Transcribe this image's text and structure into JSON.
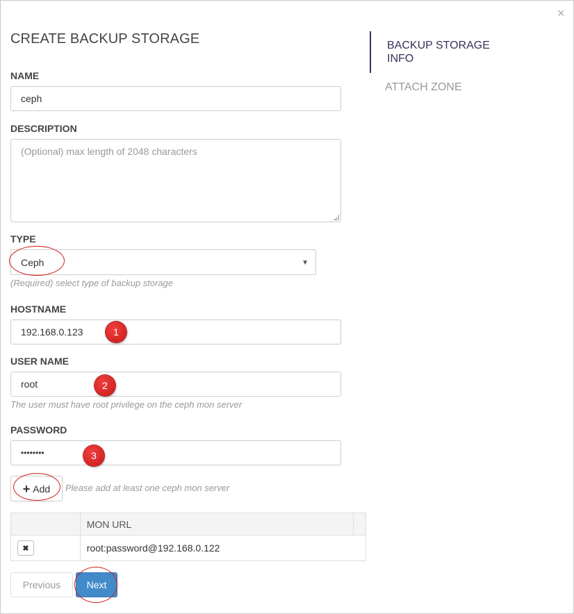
{
  "dialog": {
    "title": "CREATE BACKUP STORAGE",
    "close_symbol": "×"
  },
  "form": {
    "name": {
      "label": "NAME",
      "value": "ceph"
    },
    "description": {
      "label": "DESCRIPTION",
      "placeholder": "(Optional) max length of 2048 characters"
    },
    "type": {
      "label": "TYPE",
      "value": "Ceph",
      "help": "(Required) select type of backup storage"
    },
    "hostname": {
      "label": "HOSTNAME",
      "value": "192.168.0.123"
    },
    "username": {
      "label": "USER NAME",
      "value": "root",
      "help": "The user must have root privilege on the ceph mon server"
    },
    "password": {
      "label": "PASSWORD",
      "value": "••••••••"
    }
  },
  "mon_servers": {
    "add_label": "Add",
    "hint": "Please add at least one ceph mon server",
    "columns": [
      "",
      "MON URL"
    ],
    "rows": [
      {
        "url": "root:password@192.168.0.122"
      }
    ]
  },
  "buttons": {
    "previous": "Previous",
    "next": "Next"
  },
  "steps": {
    "active": "BACKUP STORAGE INFO",
    "next": "ATTACH ZONE"
  },
  "annotations": [
    "1",
    "2",
    "3"
  ],
  "colors": {
    "accent": "#428bca",
    "annotation_red": "#e02828",
    "active_step": "#3a2e5a"
  }
}
